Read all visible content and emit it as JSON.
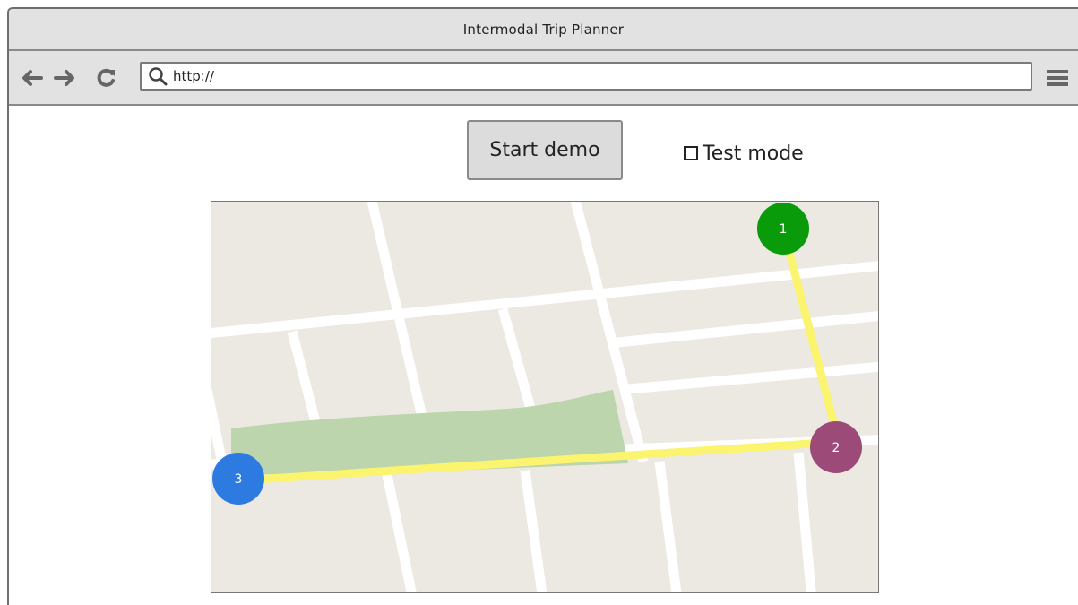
{
  "window": {
    "title": "Intermodal Trip Planner"
  },
  "toolbar": {
    "back_icon": "arrow-left-icon",
    "forward_icon": "arrow-right-icon",
    "refresh_icon": "refresh-icon",
    "search_icon": "search-icon",
    "menu_icon": "hamburger-menu-icon",
    "url_value": "http://"
  },
  "controls": {
    "start_demo_label": "Start demo",
    "test_mode_label": "Test mode",
    "test_mode_checked": false
  },
  "map": {
    "colors": {
      "land": "#ece9e2",
      "road": "#ffffff",
      "park": "#bcd5ad",
      "route": "#fbf46f"
    },
    "markers": [
      {
        "label": "1",
        "color": "#0a9b0a"
      },
      {
        "label": "2",
        "color": "#9c4a78"
      },
      {
        "label": "3",
        "color": "#2d7be0"
      }
    ]
  }
}
